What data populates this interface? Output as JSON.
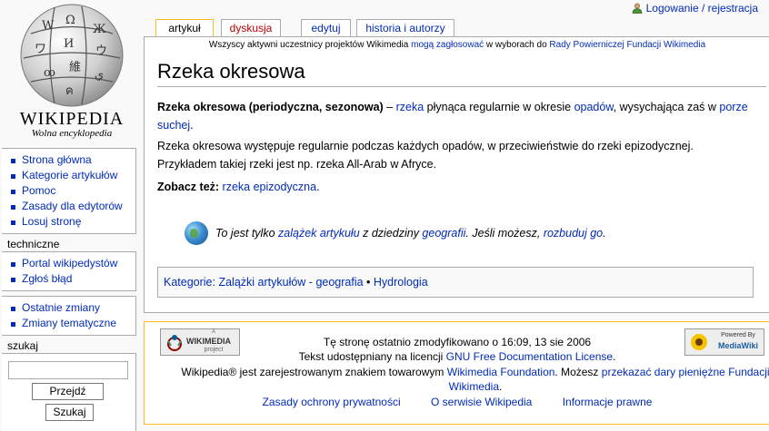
{
  "logo": {
    "wordmark": "WIKIPEDIA",
    "tagline": "Wolna encyklopedia"
  },
  "login": "Logowanie / rejestracja",
  "tabs": [
    {
      "label": "artykuł",
      "state": "selected"
    },
    {
      "label": "dyskusja",
      "state": "new"
    },
    {
      "label": "edytuj",
      "state": "normal"
    },
    {
      "label": "historia i autorzy",
      "state": "normal"
    }
  ],
  "sitenotice": {
    "prefix": "Wszyscy aktywni uczestnicy projektów Wikimedia ",
    "link1": "mogą zagłosować",
    "middle": " w wyborach do ",
    "link2": "Rady Powierniczej Fundacji Wikimedia"
  },
  "article": {
    "title": "Rzeka okresowa",
    "p1_bold": "Rzeka okresowa (periodyczna, sezonowa)",
    "p1_dash": " – ",
    "p1_link1": "rzeka",
    "p1_text1": " płynąca regularnie w okresie ",
    "p1_link2": "opadów",
    "p1_text2": ", wysychająca zaś w ",
    "p1_link3": "porze suchej",
    "p1_end": ".",
    "p2_line1": "Rzeka okresowa występuje regularnie podczas każdych opadów, w przeciwieństwie do rzeki epizodycznej.",
    "p2_line2": "Przykładem takiej rzeki jest np. rzeka All-Arab w Afryce.",
    "see_also_label": "Zobacz też:",
    "see_also_link": "rzeka epizodyczna",
    "see_also_end": ".",
    "stub_text1": "To jest tylko ",
    "stub_link1": "zalążek artykułu",
    "stub_text2": " z dziedziny ",
    "stub_link2": "geografii",
    "stub_text3": ". Jeśli możesz, ",
    "stub_link3": "rozbuduj go",
    "stub_end": ".",
    "categories_label": "Kategorie",
    "categories_sep": ": ",
    "cat1": "Zalążki artykułów - geografia",
    "cat_bullet": " • ",
    "cat2": "Hydrologia"
  },
  "sidebar": {
    "navigation": [
      "Strona główna",
      "Kategorie artykułów",
      "Pomoc",
      "Zasady dla edytorów",
      "Losuj stronę"
    ],
    "tech_heading": "techniczne",
    "tech": [
      "Portal wikipedystów",
      "Zgłoś błąd"
    ],
    "changes": [
      "Ostatnie zmiany",
      "Zmiany tematyczne"
    ],
    "search_heading": "szukaj",
    "search_value": "",
    "go_button": "Przejdź",
    "search_button": "Szukaj"
  },
  "footer": {
    "wikimedia_badge_top": "A",
    "wikimedia_badge_main": "WIKIMEDIA",
    "wikimedia_badge_sub": "project",
    "mediawiki_badge_top": "Powered By",
    "mediawiki_badge_main": "MediaWiki",
    "modified": "Tę stronę ostatnio zmodyfikowano o 16:09, 13 sie 2006",
    "license_text": "Tekst udostępniany na licencji ",
    "license_link": "GNU Free Documentation License",
    "license_end": ".",
    "tm_text": "Wikipedia® jest zarejestrowanym znakiem towarowym ",
    "tm_link": "Wikimedia Foundation",
    "tm_mid": ". Możesz ",
    "tm_link2_line1": "przekazać dary pieniężne Fundacji",
    "tm_link2_line2": "Wikimedia",
    "tm_end": ".",
    "links": [
      "Zasady ochrony prywatności",
      "O serwisie Wikipedia",
      "Informacje prawne"
    ]
  }
}
